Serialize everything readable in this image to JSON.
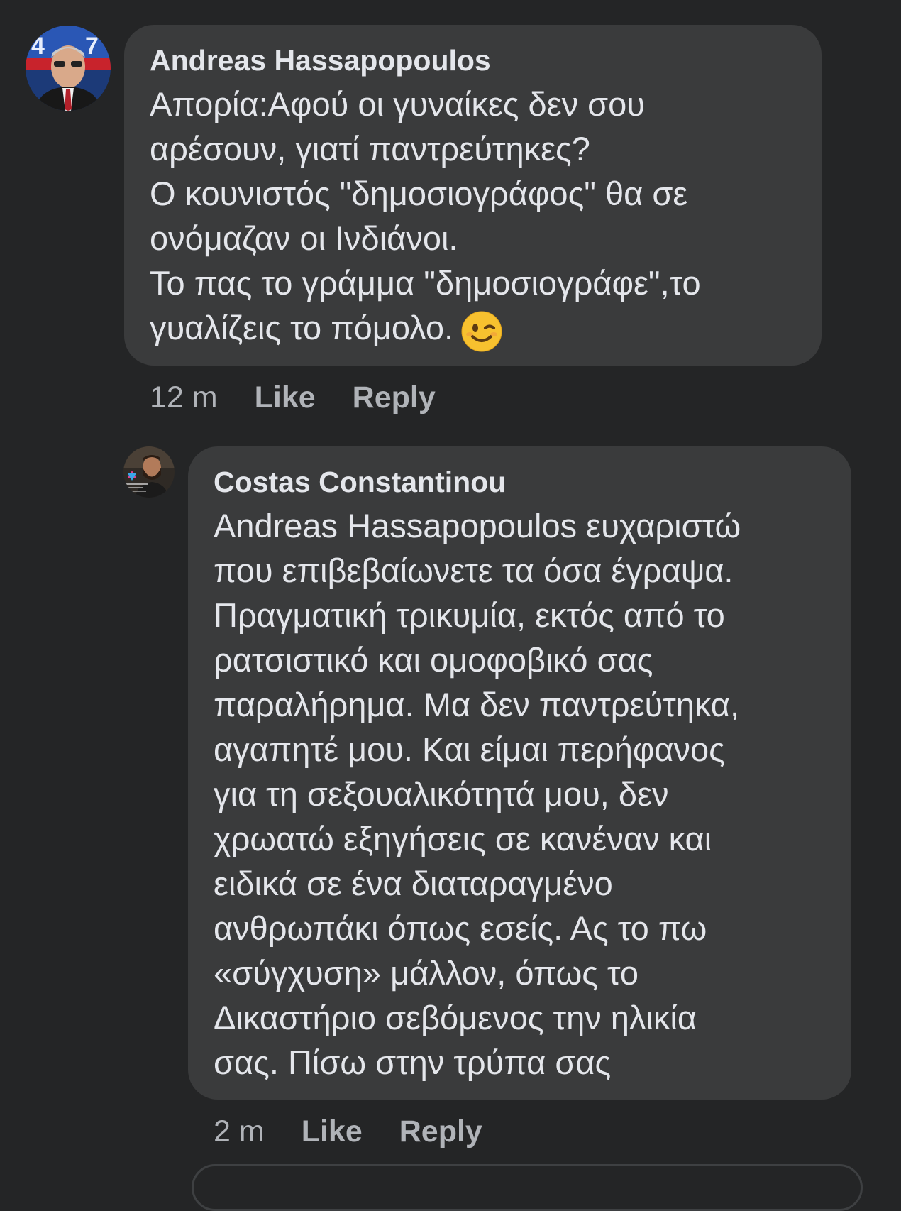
{
  "comments": [
    {
      "author": "Andreas Hassapopoulos",
      "avatar": "avatar-photo-man-in-suit",
      "lines": [
        "Απορία:Αφού οι γυναίκες δεν σου",
        "αρέσουν, γιατί παντρεύτηκες?",
        "Ο κουνιστός \"δημοσιογράφος\" θα σε",
        "ονόμαζαν οι Ινδιάνοι.",
        "Το πας το γράμμα \"δημοσιογράφε\",το",
        "γυαλίζεις το πόμολο."
      ],
      "emoji": "winking-face-emoji",
      "time": "12 m",
      "like": "Like",
      "reply": "Reply"
    },
    {
      "author": "Costas Constantinou",
      "avatar": "avatar-photo-bearded-man",
      "lines": [
        "Andreas Hassapopoulos ευχαριστώ",
        "που επιβεβαίωνετε τα όσα έγραψα.",
        "Πραγματική τρικυμία, εκτός από το",
        "ρατσιστικό και ομοφοβικό σας",
        "παραλήρημα. Μα δεν παντρεύτηκα,",
        "αγαπητέ μου. Και είμαι περήφανος",
        "για τη σεξουαλικότητά μου, δεν",
        "χρωατώ εξηγήσεις σε κανέναν και",
        "ειδικά σε ένα διαταραγμένο",
        "ανθρωπάκι όπως εσείς. Ας το πω",
        "«σύγχυση» μάλλον, όπως το",
        "Δικαστήριο σεβόμενος την ηλικία",
        "σας. Πίσω στην τρύπα σας"
      ],
      "time": "2 m",
      "like": "Like",
      "reply": "Reply"
    }
  ],
  "colors": {
    "background": "#242526",
    "bubble": "#3a3b3c",
    "text": "#e4e6eb",
    "secondary_text": "#b0b3b8"
  }
}
